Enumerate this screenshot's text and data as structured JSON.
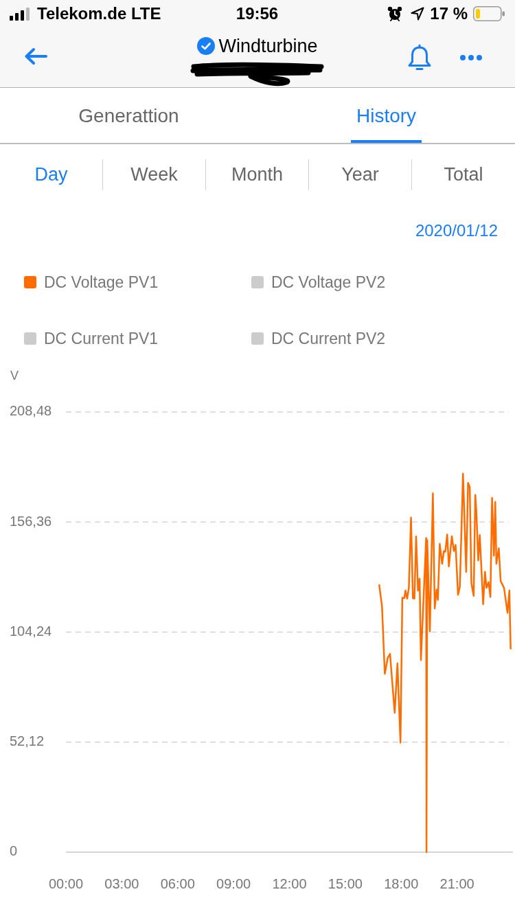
{
  "status_bar": {
    "carrier": "Telekom.de LTE",
    "time": "19:56",
    "battery": "17 %"
  },
  "nav": {
    "title": "Windturbine"
  },
  "tabs": [
    {
      "label": "Generattion",
      "selected": false
    },
    {
      "label": "History",
      "selected": true
    }
  ],
  "periods": [
    {
      "label": "Day",
      "selected": true
    },
    {
      "label": "Week",
      "selected": false
    },
    {
      "label": "Month",
      "selected": false
    },
    {
      "label": "Year",
      "selected": false
    },
    {
      "label": "Total",
      "selected": false
    }
  ],
  "date": "2020/01/12",
  "legend": [
    {
      "label": "DC Voltage PV1",
      "selected": true
    },
    {
      "label": "DC Voltage PV2",
      "selected": false
    },
    {
      "label": "DC Current PV1",
      "selected": false
    },
    {
      "label": "DC Current PV2",
      "selected": false
    }
  ],
  "chart": {
    "chart_data": {
      "type": "line",
      "ylabel": "V",
      "grid": true,
      "x": [
        16.82,
        16.97,
        17.12,
        17.28,
        17.4,
        17.65,
        17.8,
        17.96,
        18.06,
        18.17,
        18.23,
        18.32,
        18.41,
        18.53,
        18.63,
        18.71,
        18.8,
        18.9,
        18.99,
        19.06,
        19.34,
        19.36,
        19.4,
        19.54,
        19.7,
        19.8,
        19.9,
        19.97,
        20.07,
        20.2,
        20.29,
        20.37,
        20.47,
        20.56,
        20.72,
        20.83,
        20.92,
        21.05,
        21.15,
        21.32,
        21.49,
        21.59,
        21.68,
        21.77,
        21.89,
        21.98,
        22.04,
        22.14,
        22.22,
        22.4,
        22.5,
        22.58,
        22.69,
        22.79,
        22.88,
        22.98,
        23.05,
        23.11,
        23.24,
        23.34,
        23.52,
        23.71,
        23.81,
        23.88
      ],
      "series": [
        {
          "color": "#ff6d00",
          "values": [
            126.8,
            116.5,
            84.5,
            92.1,
            93.9,
            66.0,
            89.4,
            51.9,
            120.5,
            120.3,
            123.9,
            120.1,
            125.2,
            158.5,
            120.3,
            120.1,
            149.5,
            123.9,
            129.5,
            91.0,
            148.8,
            0,
            147.8,
            104.6,
            169.9,
            115.4,
            124.3,
            119.5,
            146.0,
            136.6,
            142.6,
            142.3,
            150.4,
            135.3,
            149.6,
            142.6,
            145.5,
            121.9,
            125.7,
            179.3,
            132.8,
            174.9,
            173.0,
            127.4,
            121.4,
            169.2,
            161.0,
            138.2,
            150.2,
            117.4,
            132.8,
            125.2,
            127.9,
            120.8,
            167.8,
            140.4,
            165.9,
            136.6,
            143.9,
            128.4,
            125.2,
            113.3,
            123.9,
            96.1
          ]
        }
      ],
      "xlim": [
        0,
        24
      ],
      "ylim": [
        0,
        208.48
      ],
      "xticks": [
        {
          "value": 0,
          "label": "00:00"
        },
        {
          "value": 3,
          "label": "03:00"
        },
        {
          "value": 6,
          "label": "06:00"
        },
        {
          "value": 9,
          "label": "09:00"
        },
        {
          "value": 12,
          "label": "12:00"
        },
        {
          "value": 15,
          "label": "15:00"
        },
        {
          "value": 18,
          "label": "18:00"
        },
        {
          "value": 21,
          "label": "21:00"
        }
      ],
      "yticks": [
        {
          "value": 0,
          "label": "0"
        },
        {
          "value": 52.12,
          "label": "52,12"
        },
        {
          "value": 104.24,
          "label": "104,24"
        },
        {
          "value": 156.36,
          "label": "156,36"
        },
        {
          "value": 208.48,
          "label": "208,48"
        }
      ]
    }
  }
}
